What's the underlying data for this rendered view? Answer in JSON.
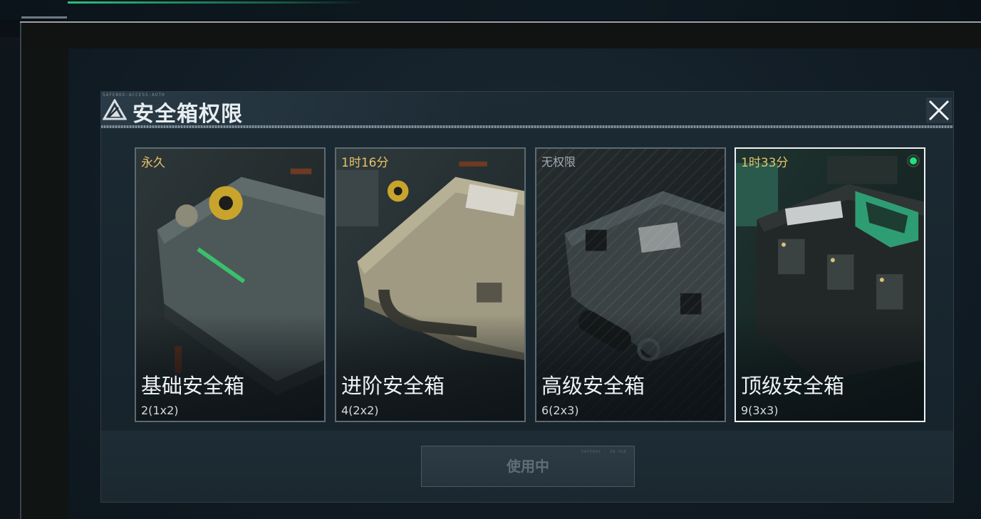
{
  "dialog": {
    "header_micro": "SAFEBOX-ACCESS·AUTH",
    "title": "安全箱权限",
    "close_label": "×"
  },
  "cards": [
    {
      "id": "basic",
      "tag": "永久",
      "name": "基础安全箱",
      "capacity": "2(1x2)",
      "selected": false,
      "locked": false
    },
    {
      "id": "advanced",
      "tag": "1时16分",
      "name": "进阶安全箱",
      "capacity": "4(2x2)",
      "selected": false,
      "locked": false
    },
    {
      "id": "senior",
      "tag": "无权限",
      "name": "高级安全箱",
      "capacity": "6(2x3)",
      "selected": false,
      "locked": true
    },
    {
      "id": "top",
      "tag": "1时33分",
      "name": "顶级安全箱",
      "capacity": "9(3x3)",
      "selected": true,
      "locked": false
    }
  ],
  "footer": {
    "use_button_label": "使用中",
    "use_button_micro": "SAFEBOX · IN USE"
  },
  "colors": {
    "tag_gold": "#e6c46a",
    "tag_muted": "#a2acb2",
    "selected_border": "#f0f3f5",
    "active_dot": "#22e07a",
    "accent_green": "#2bbf7e"
  },
  "icons": {
    "title": "triangle-logo-icon",
    "close": "close-icon",
    "active": "active-dot-icon"
  }
}
